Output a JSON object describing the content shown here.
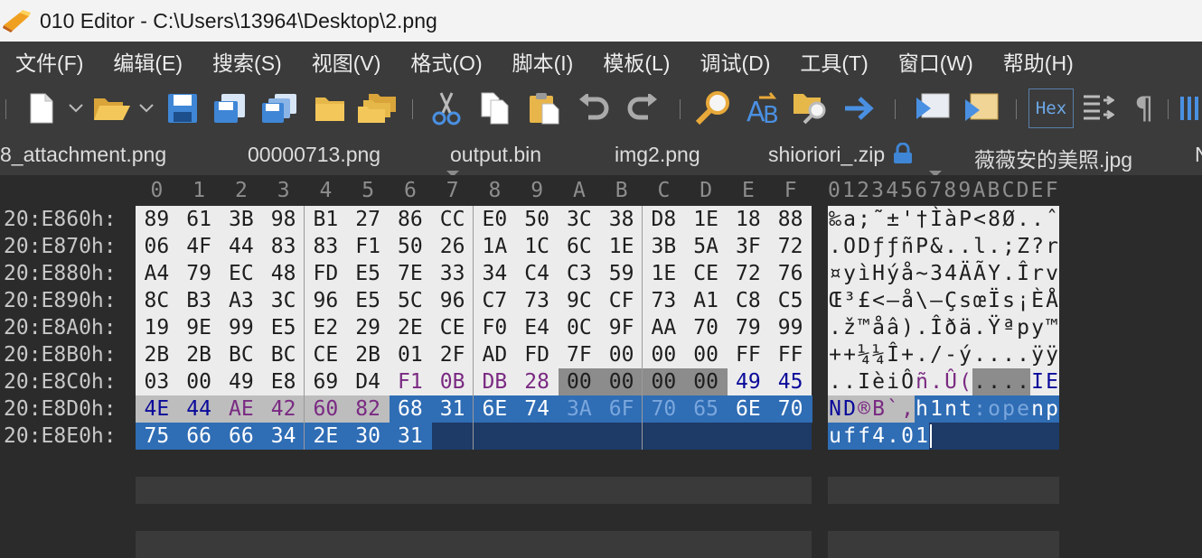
{
  "window": {
    "title": "010 Editor - C:\\Users\\13964\\Desktop\\2.png"
  },
  "menu": [
    "文件(F)",
    "编辑(E)",
    "搜索(S)",
    "视图(V)",
    "格式(O)",
    "脚本(I)",
    "模板(L)",
    "调试(D)",
    "工具(T)",
    "窗口(W)",
    "帮助(H)"
  ],
  "toolbar": {
    "hex_label": "Hex",
    "pilcrow": "¶",
    "icons": [
      "new-file-icon",
      "open-folder-icon",
      "save-icon",
      "save-as-icon",
      "save-all-icon",
      "open-folder-plain-icon",
      "open-workspace-icon",
      "cut-icon",
      "copy-icon",
      "paste-icon",
      "undo-icon",
      "redo-icon",
      "find-icon",
      "replace-icon",
      "find-in-files-icon",
      "goto-icon",
      "run-script-icon",
      "run-template-icon",
      "hex-mode-icon",
      "compare-icon",
      "show-whitespace-icon",
      "columns-icon"
    ]
  },
  "tabs": [
    "8_attachment.png",
    "00000713.png",
    "output.bin",
    "img2.png",
    "shioriori_.zip",
    "薇薇安的美照.jpg",
    "N"
  ],
  "colors": {
    "normal_hex": "#1e1e1e",
    "purple": "#7a2a82",
    "blue_text": "#0a0a9a",
    "selection": "#2f6db5",
    "selection_light": "#7aa7dd",
    "gray_highlight": "#8c8c8c",
    "navy": "#1e3a66"
  },
  "hex": {
    "column_headers": [
      "0",
      "1",
      "2",
      "3",
      "4",
      "5",
      "6",
      "7",
      "8",
      "9",
      "A",
      "B",
      "C",
      "D",
      "E",
      "F"
    ],
    "ascii_header": "0123456789ABCDEF",
    "rows": [
      {
        "address": "20:E860h:",
        "bytes": [
          "89",
          "61",
          "3B",
          "98",
          "B1",
          "27",
          "86",
          "CC",
          "E0",
          "50",
          "3C",
          "38",
          "D8",
          "1E",
          "18",
          "88"
        ],
        "ascii": [
          "‰",
          "a",
          ";",
          "˜",
          "±",
          "'",
          "†",
          "Ì",
          "à",
          "P",
          "<",
          "8",
          "Ø",
          ".",
          ".",
          "ˆ"
        ]
      },
      {
        "address": "20:E870h:",
        "bytes": [
          "06",
          "4F",
          "44",
          "83",
          "83",
          "F1",
          "50",
          "26",
          "1A",
          "1C",
          "6C",
          "1E",
          "3B",
          "5A",
          "3F",
          "72"
        ],
        "ascii": [
          ".",
          "O",
          "D",
          "ƒ",
          "ƒ",
          "ñ",
          "P",
          "&",
          ".",
          ".",
          "l",
          ".",
          ";",
          "Z",
          "?",
          "r"
        ]
      },
      {
        "address": "20:E880h:",
        "bytes": [
          "A4",
          "79",
          "EC",
          "48",
          "FD",
          "E5",
          "7E",
          "33",
          "34",
          "C4",
          "C3",
          "59",
          "1E",
          "CE",
          "72",
          "76"
        ],
        "ascii": [
          "¤",
          "y",
          "ì",
          "H",
          "ý",
          "å",
          "~",
          "3",
          "4",
          "Ä",
          "Ã",
          "Y",
          ".",
          "Î",
          "r",
          "v"
        ]
      },
      {
        "address": "20:E890h:",
        "bytes": [
          "8C",
          "B3",
          "A3",
          "3C",
          "96",
          "E5",
          "5C",
          "96",
          "C7",
          "73",
          "9C",
          "CF",
          "73",
          "A1",
          "C8",
          "C5"
        ],
        "ascii": [
          "Œ",
          "³",
          "£",
          "<",
          "–",
          "å",
          "\\",
          "–",
          "Ç",
          "s",
          "œ",
          "Ï",
          "s",
          "¡",
          "È",
          "Å"
        ]
      },
      {
        "address": "20:E8A0h:",
        "bytes": [
          "19",
          "9E",
          "99",
          "E5",
          "E2",
          "29",
          "2E",
          "CE",
          "F0",
          "E4",
          "0C",
          "9F",
          "AA",
          "70",
          "79",
          "99"
        ],
        "ascii": [
          ".",
          "ž",
          "™",
          "å",
          "â",
          ")",
          ".",
          "Î",
          "ð",
          "ä",
          ".",
          "Ÿ",
          "ª",
          "p",
          "y",
          "™"
        ]
      },
      {
        "address": "20:E8B0h:",
        "bytes": [
          "2B",
          "2B",
          "BC",
          "BC",
          "CE",
          "2B",
          "01",
          "2F",
          "AD",
          "FD",
          "7F",
          "00",
          "00",
          "00",
          "FF",
          "FF"
        ],
        "ascii": [
          "+",
          "+",
          "¼",
          "¼",
          "Î",
          "+",
          ".",
          "/",
          "-",
          "ý",
          ".",
          ".",
          ".",
          ".",
          "ÿ",
          "ÿ"
        ]
      },
      {
        "address": "20:E8C0h:",
        "bytes": [
          "03",
          "00",
          "49",
          "E8",
          "69",
          "D4",
          "F1",
          "0B",
          "DB",
          "28",
          "00",
          "00",
          "00",
          "00",
          "49",
          "45"
        ],
        "ascii": [
          ".",
          ".",
          "I",
          "è",
          "i",
          "Ô",
          "ñ",
          ".",
          "Û",
          "(",
          ".",
          ".",
          ".",
          ".",
          "I",
          "E"
        ]
      },
      {
        "address": "20:E8D0h:",
        "bytes": [
          "4E",
          "44",
          "AE",
          "42",
          "60",
          "82",
          "68",
          "31",
          "6E",
          "74",
          "3A",
          "6F",
          "70",
          "65",
          "6E",
          "70"
        ],
        "ascii": [
          "N",
          "D",
          "®",
          "B",
          "`",
          ",",
          "h",
          "1",
          "n",
          "t",
          ":",
          "o",
          "p",
          "e",
          "n",
          "p"
        ]
      },
      {
        "address": "20:E8E0h:",
        "bytes": [
          "75",
          "66",
          "66",
          "34",
          "2E",
          "30",
          "31"
        ],
        "ascii": [
          "u",
          "f",
          "f",
          "4",
          ".",
          "0",
          "1"
        ]
      }
    ]
  }
}
